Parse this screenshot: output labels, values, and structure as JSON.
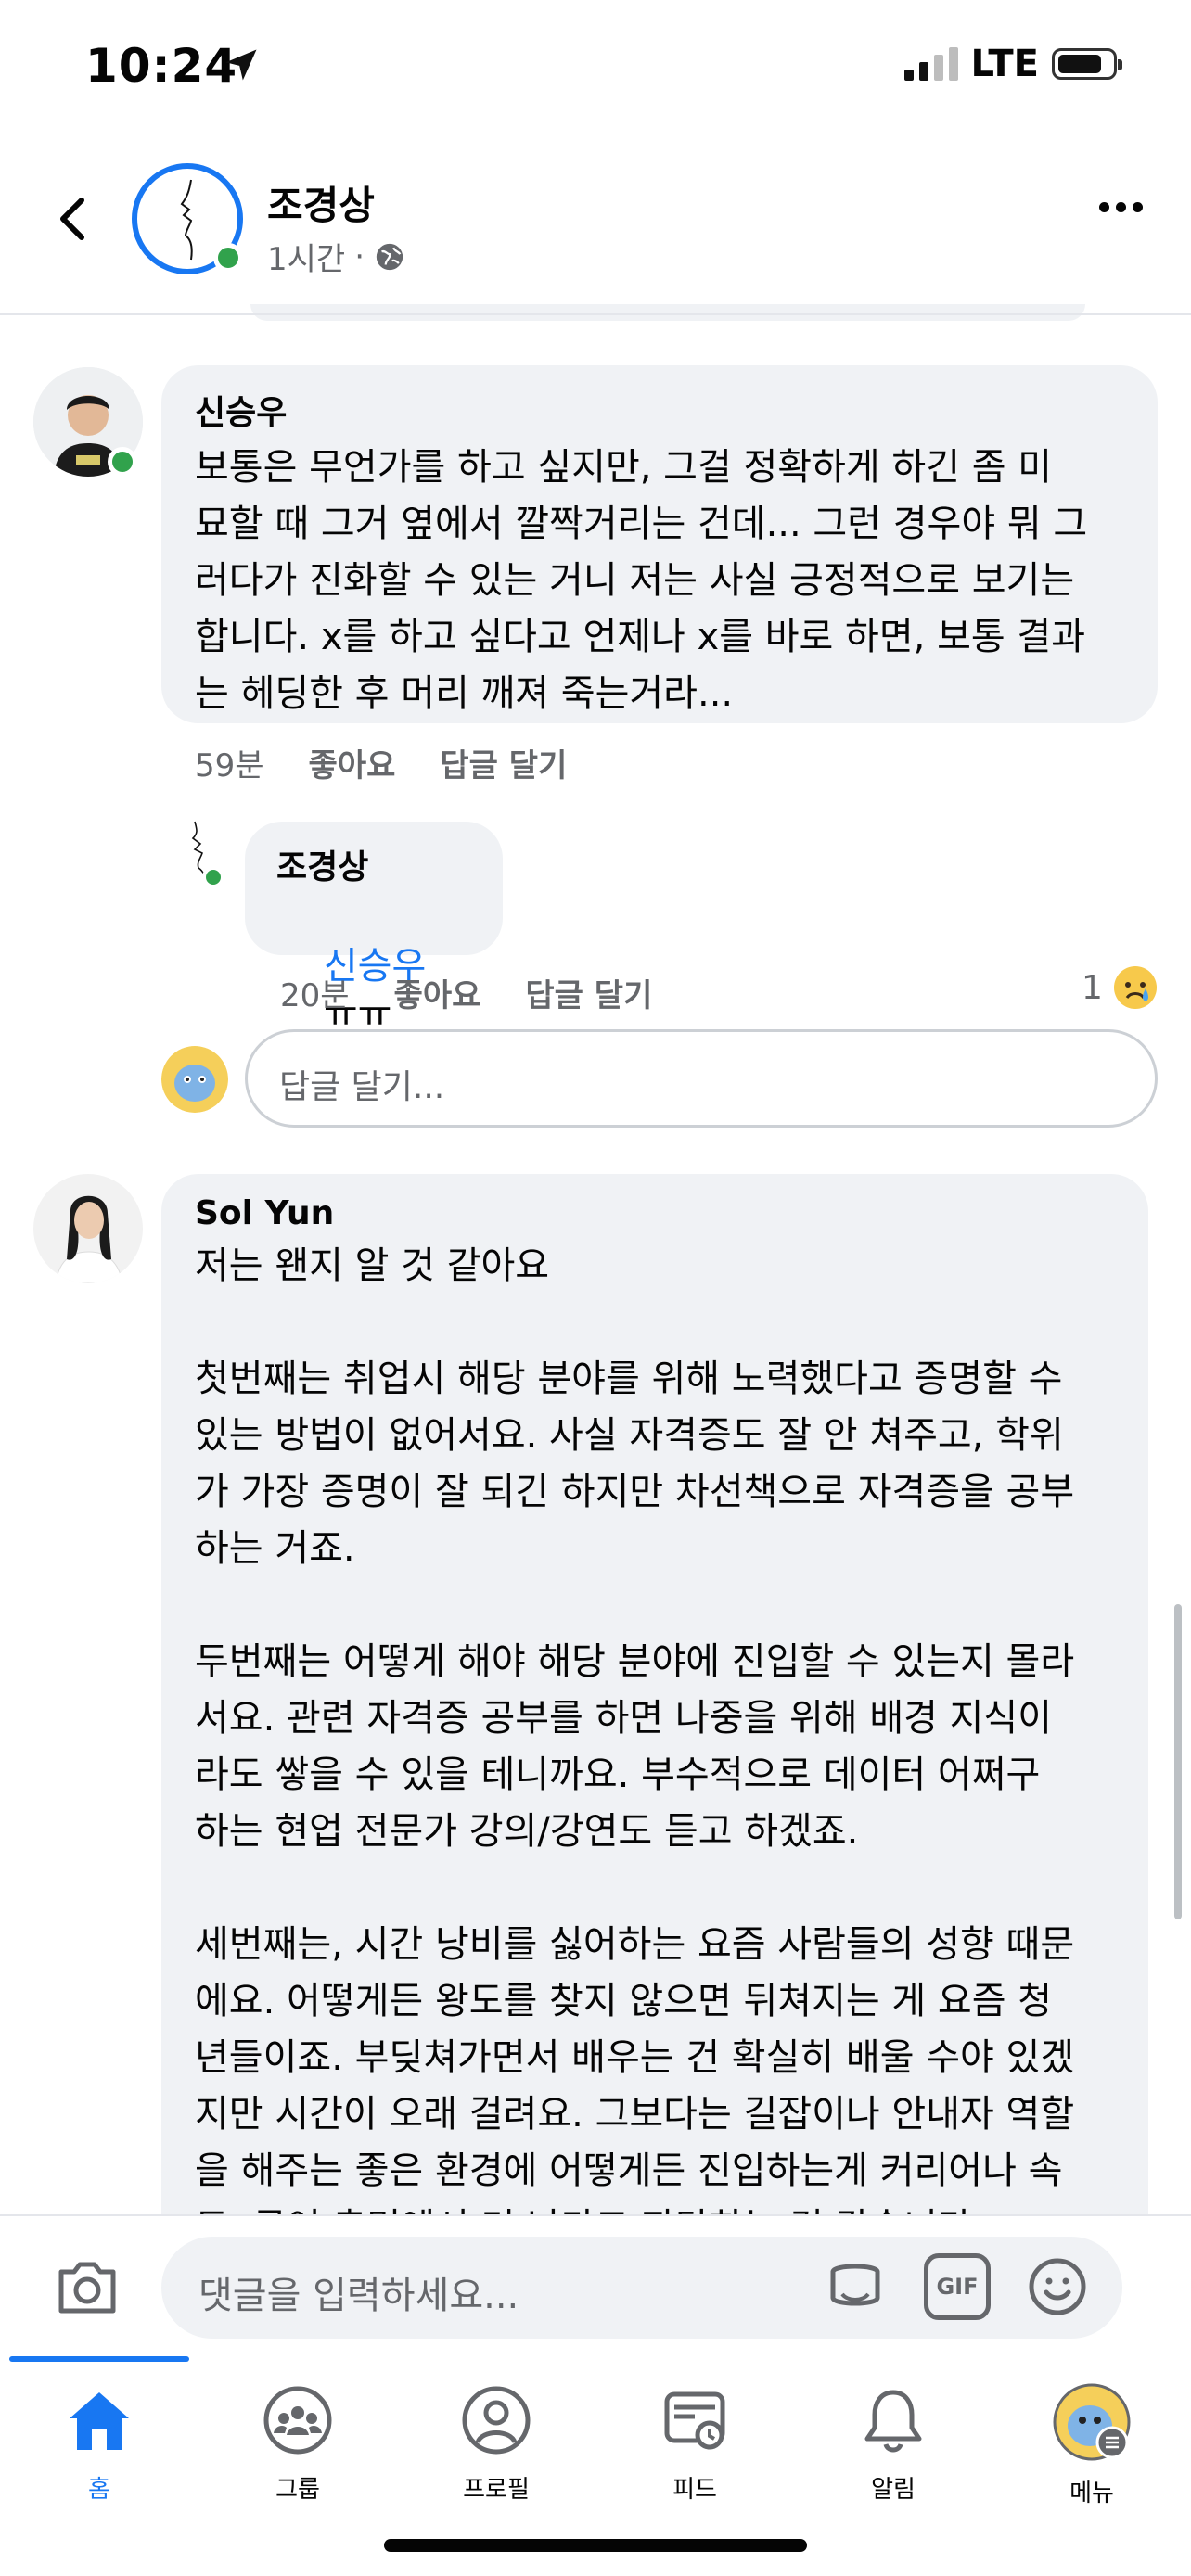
{
  "status_bar": {
    "time": "10:24",
    "network": "LTE"
  },
  "header": {
    "name": "조경상",
    "time": "1시간",
    "separator": "·"
  },
  "comments": [
    {
      "author": "신승우",
      "text": "보통은 무언가를 하고 싶지만, 그걸 정확하게 하긴 좀 미\n묘할 때 그거 옆에서 깔짝거리는 건데... 그런 경우야 뭐 그\n러다가 진화할 수 있는 거니 저는 사실 긍정적으로 보기는\n합니다. x를 하고 싶다고 언제나 x를 바로 하면, 보통 결과\n는 헤딩한 후 머리 깨져 죽는거라...",
      "time": "59분",
      "like": "좋아요",
      "reply": "답글 달기"
    },
    {
      "author": "Sol Yun",
      "text": "저는 왠지 알 것 같아요\n\n첫번째는 취업시 해당 분야를 위해 노력했다고 증명할 수\n있는 방법이 없어서요. 사실 자격증도 잘 안 쳐주고, 학위\n가 가장 증명이 잘 되긴 하지만 차선책으로 자격증을 공부\n하는 거죠.\n\n두번째는 어떻게 해야 해당 분야에 진입할 수 있는지 몰라\n서요. 관련 자격증 공부를 하면 나중을 위해 배경 지식이\n라도 쌓을 수 있을 테니까요. 부수적으로 데이터 어쩌구\n하는 현업 전문가 강의/강연도 듣고 하겠죠.\n\n세번째는, 시간 낭비를 싫어하는 요즘 사람들의 성향 때문\n에요. 어떻게든 왕도를 찾지 않으면 뒤쳐지는 게 요즘 청\n년들이죠. 부딪쳐가면서 배우는 건 확실히 배울 수야 있겠\n지만 시간이 오래 걸려요. 그보다는 길잡이나 안내자 역할\n을 해주는 좋은 환경에 어떻게든 진입하는게 커리어나 속\n도, 급여 측면에서 더 낫다고 판단하는 것 같습니다."
    }
  ],
  "reply": {
    "author": "조경상",
    "mention": "신승우",
    "text": "ㅠㅠ",
    "time": "20분",
    "like": "좋아요",
    "reply": "답글 달기",
    "reaction_count": "1"
  },
  "reply_input": {
    "placeholder": "답글 달기..."
  },
  "composer": {
    "placeholder": "댓글을 입력하세요...",
    "gif_label": "GIF"
  },
  "tabs": [
    {
      "label": "홈",
      "icon": "home-icon",
      "active": true
    },
    {
      "label": "그룹",
      "icon": "groups-icon"
    },
    {
      "label": "프로필",
      "icon": "profile-icon"
    },
    {
      "label": "피드",
      "icon": "feed-icon"
    },
    {
      "label": "알림",
      "icon": "bell-icon"
    },
    {
      "label": "메뉴",
      "icon": "menu-avatar-icon"
    }
  ],
  "colors": {
    "accent": "#1877f2",
    "online": "#31a24c",
    "bubble": "#f0f2f5",
    "secondary_text": "#65676b"
  }
}
